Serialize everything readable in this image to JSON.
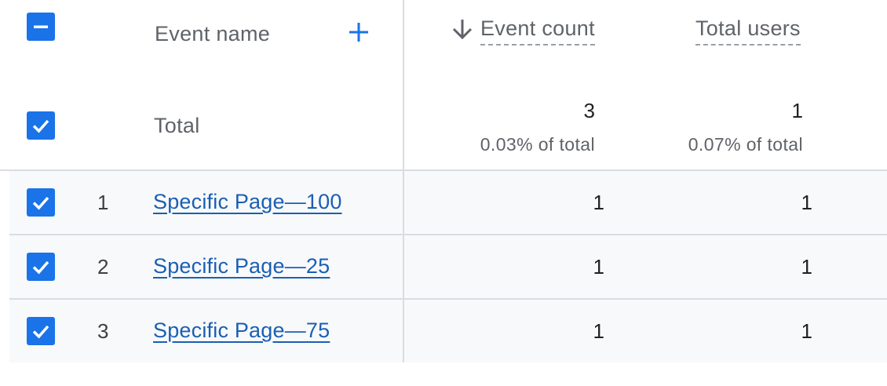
{
  "header": {
    "event_name_label": "Event name",
    "event_count_label": "Event count",
    "total_users_label": "Total users",
    "sort_direction": "descending",
    "add_icon": "plus-icon"
  },
  "totals": {
    "label": "Total",
    "event_count": "3",
    "event_count_pct": "0.03% of total",
    "total_users": "1",
    "total_users_pct": "0.07% of total"
  },
  "rows": [
    {
      "index": "1",
      "event_name": "Specific Page—100",
      "event_count": "1",
      "total_users": "1",
      "checked": true
    },
    {
      "index": "2",
      "event_name": "Specific Page—25",
      "event_count": "1",
      "total_users": "1",
      "checked": true
    },
    {
      "index": "3",
      "event_name": "Specific Page—75",
      "event_count": "1",
      "total_users": "1",
      "checked": true
    }
  ],
  "colors": {
    "accent": "#1a73e8",
    "link": "#1a5fb4",
    "row_bg": "#f8f9fa",
    "divider": "#dadce0"
  }
}
